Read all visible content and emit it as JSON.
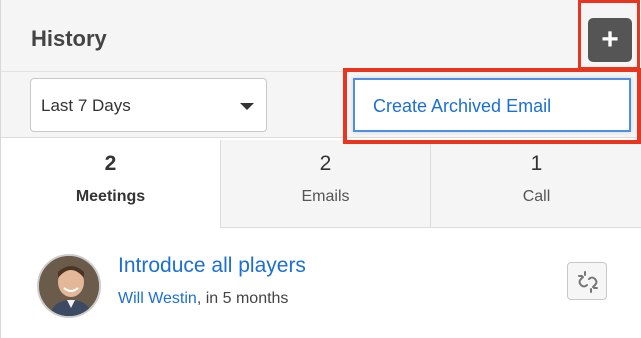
{
  "dashlet": {
    "title": "History",
    "add_button": "+"
  },
  "filter": {
    "selected": "Last 7 Days"
  },
  "menu": {
    "items": [
      "Create Archived Email"
    ]
  },
  "tabs": [
    {
      "count": "2",
      "label": "Meetings",
      "active": true
    },
    {
      "count": "2",
      "label": "Emails",
      "active": false
    },
    {
      "count": "1",
      "label": "Call",
      "active": false
    }
  ],
  "records": [
    {
      "title": "Introduce all players",
      "assigned_user": "Will Westin",
      "time": ", in 5 months"
    }
  ],
  "colors": {
    "highlight": "#e8351f",
    "link": "#1b6fd6",
    "header_bg": "#f5f5f5"
  }
}
